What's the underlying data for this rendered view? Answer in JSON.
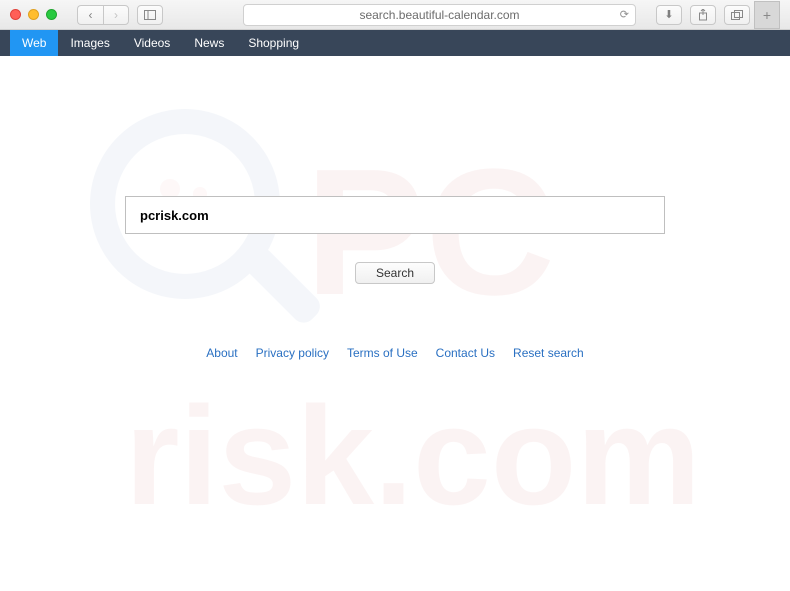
{
  "browser": {
    "url": "search.beautiful-calendar.com"
  },
  "nav": {
    "items": [
      {
        "label": "Web",
        "active": true
      },
      {
        "label": "Images",
        "active": false
      },
      {
        "label": "Videos",
        "active": false
      },
      {
        "label": "News",
        "active": false
      },
      {
        "label": "Shopping",
        "active": false
      }
    ]
  },
  "search": {
    "value": "pcrisk.com",
    "button_label": "Search"
  },
  "footer": {
    "links": [
      "About",
      "Privacy policy",
      "Terms of Use",
      "Contact Us",
      "Reset search"
    ]
  }
}
